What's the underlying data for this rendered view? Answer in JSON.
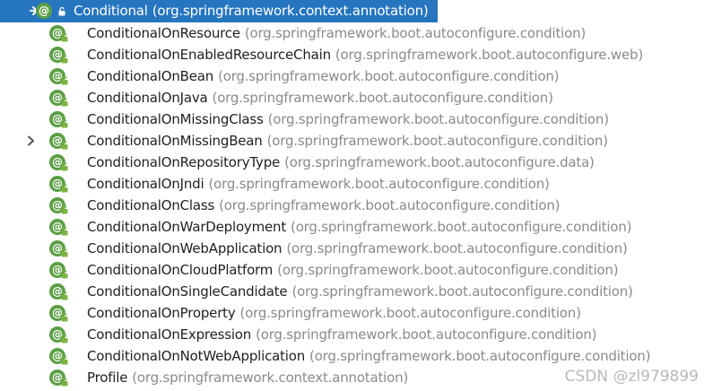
{
  "tree": {
    "root": {
      "name": "Conditional",
      "package": "(org.springframework.context.annotation)",
      "icon": "annotation-icon"
    },
    "children": [
      {
        "name": "ConditionalOnResource",
        "package": "(org.springframework.boot.autoconfigure.condition)",
        "expandable": false
      },
      {
        "name": "ConditionalOnEnabledResourceChain",
        "package": "(org.springframework.boot.autoconfigure.web)",
        "expandable": false
      },
      {
        "name": "ConditionalOnBean",
        "package": "(org.springframework.boot.autoconfigure.condition)",
        "expandable": false
      },
      {
        "name": "ConditionalOnJava",
        "package": "(org.springframework.boot.autoconfigure.condition)",
        "expandable": false
      },
      {
        "name": "ConditionalOnMissingClass",
        "package": "(org.springframework.boot.autoconfigure.condition)",
        "expandable": false
      },
      {
        "name": "ConditionalOnMissingBean",
        "package": "(org.springframework.boot.autoconfigure.condition)",
        "expandable": true
      },
      {
        "name": "ConditionalOnRepositoryType",
        "package": "(org.springframework.boot.autoconfigure.data)",
        "expandable": false
      },
      {
        "name": "ConditionalOnJndi",
        "package": "(org.springframework.boot.autoconfigure.condition)",
        "expandable": false
      },
      {
        "name": "ConditionalOnClass",
        "package": "(org.springframework.boot.autoconfigure.condition)",
        "expandable": false
      },
      {
        "name": "ConditionalOnWarDeployment",
        "package": "(org.springframework.boot.autoconfigure.condition)",
        "expandable": false
      },
      {
        "name": "ConditionalOnWebApplication",
        "package": "(org.springframework.boot.autoconfigure.condition)",
        "expandable": false
      },
      {
        "name": "ConditionalOnCloudPlatform",
        "package": "(org.springframework.boot.autoconfigure.condition)",
        "expandable": false
      },
      {
        "name": "ConditionalOnSingleCandidate",
        "package": "(org.springframework.boot.autoconfigure.condition)",
        "expandable": false
      },
      {
        "name": "ConditionalOnProperty",
        "package": "(org.springframework.boot.autoconfigure.condition)",
        "expandable": false
      },
      {
        "name": "ConditionalOnExpression",
        "package": "(org.springframework.boot.autoconfigure.condition)",
        "expandable": false
      },
      {
        "name": "ConditionalOnNotWebApplication",
        "package": "(org.springframework.boot.autoconfigure.condition)",
        "expandable": false
      },
      {
        "name": "Profile",
        "package": "(org.springframework.context.annotation)",
        "expandable": false
      }
    ]
  },
  "icons": {
    "annotation_glyph": "@",
    "collapsed_arrow": "chevron-right-icon",
    "lock": "lock-icon"
  },
  "colors": {
    "selection": "#2675bf",
    "annotation_icon": "#5c9f45",
    "lock": "#7cb342",
    "name_text": "#1f1f1f",
    "package_text": "#8a8a8a"
  },
  "watermark": "CSDN @zl979899"
}
